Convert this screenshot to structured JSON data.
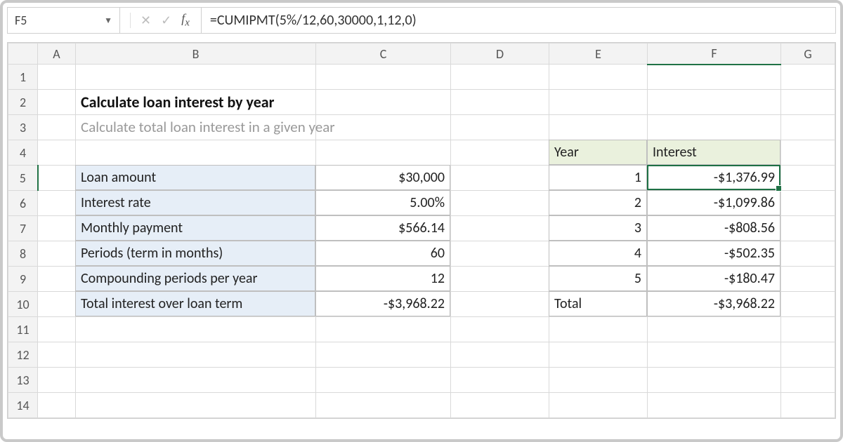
{
  "name_box": "F5",
  "formula": "=CUMIPMT(5%/12,60,30000,1,12,0)",
  "columns": [
    "A",
    "B",
    "C",
    "D",
    "E",
    "F",
    "G"
  ],
  "rows": [
    "1",
    "2",
    "3",
    "4",
    "5",
    "6",
    "7",
    "8",
    "9",
    "10",
    "11",
    "12",
    "13",
    "14"
  ],
  "active": {
    "col": "F",
    "row": "5"
  },
  "title": "Calculate loan interest by year",
  "subtitle": "Calculate total loan interest in a given year",
  "loan_labels": {
    "amount": "Loan amount",
    "rate": "Interest rate",
    "monthly": "Monthly payment",
    "periods": "Periods (term in months)",
    "compounding": "Compounding periods per year",
    "total": "Total interest over loan term"
  },
  "loan_values": {
    "amount": "$30,000",
    "rate": "5.00%",
    "monthly": "$566.14",
    "periods": "60",
    "compounding": "12",
    "total": "-$3,968.22"
  },
  "year_table": {
    "headers": {
      "year": "Year",
      "interest": "Interest"
    },
    "rows": [
      {
        "year": "1",
        "interest": "-$1,376.99"
      },
      {
        "year": "2",
        "interest": "-$1,099.86"
      },
      {
        "year": "3",
        "interest": "-$808.56"
      },
      {
        "year": "4",
        "interest": "-$502.35"
      },
      {
        "year": "5",
        "interest": "-$180.47"
      }
    ],
    "footer": {
      "label": "Total",
      "value": "-$3,968.22"
    }
  }
}
